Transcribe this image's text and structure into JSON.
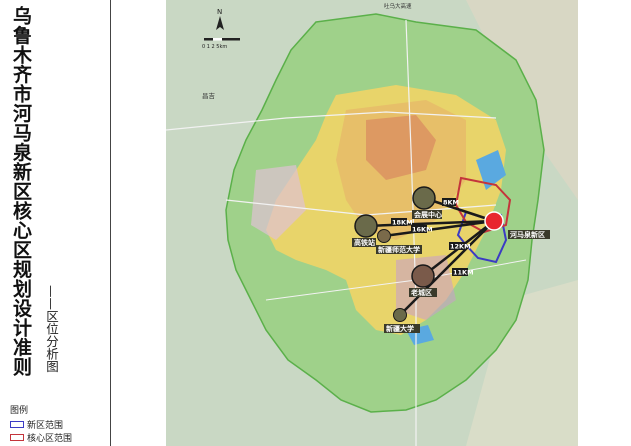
{
  "title": "乌鲁木齐市河马泉新区核心区规划设计准则",
  "subtitle": "——区位分析图",
  "legend": {
    "heading": "图例",
    "items": [
      {
        "label": "新区范围",
        "color": "#3b3bc4"
      },
      {
        "label": "核心区范围",
        "color": "#c4343b"
      }
    ]
  },
  "map": {
    "north_label": "N",
    "scale_text": "0 1 2    5km",
    "place_labels": {
      "changji": "昌吉",
      "top_road": "吐乌大高速",
      "city_center": "会展中心",
      "gaotie": "高铁站",
      "xinjiang_normal": "新疆师范大学",
      "old_town": "老城区",
      "xinjiang_univ": "新疆大学",
      "hemaquan": "河马泉新区"
    },
    "distances": {
      "to_center": "8KM",
      "to_gaotie": "18KM",
      "to_normal": "16KM",
      "to_old": "12KM",
      "to_univ": "11KM"
    },
    "colors": {
      "core_boundary": "#c4343b",
      "new_area_boundary": "#3b3bc4",
      "node_fill": "#6a6a4a",
      "connector": "#1a1a1a",
      "core_fill": "#e8262e"
    }
  }
}
